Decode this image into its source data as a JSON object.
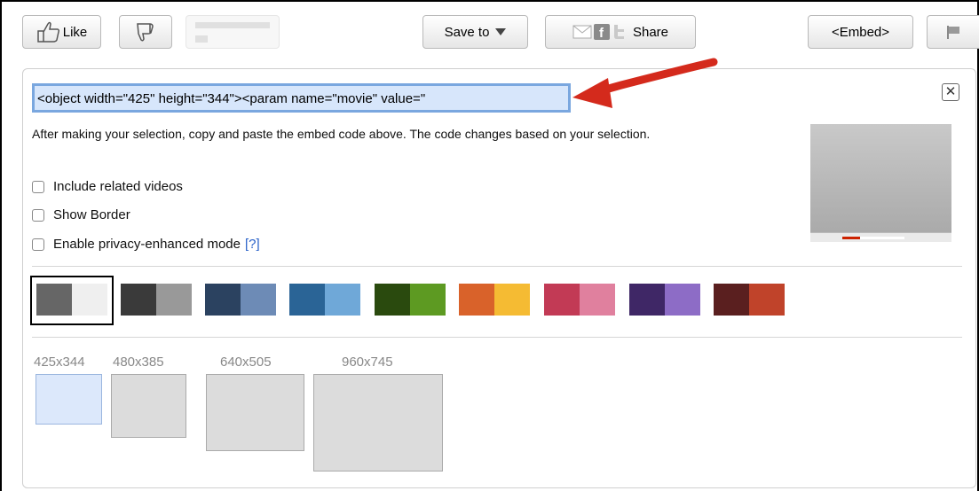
{
  "toolbar": {
    "like_label": "Like",
    "save_to_label": "Save to",
    "share_label": "Share",
    "embed_label": "<Embed>"
  },
  "embed": {
    "code": "<object width=\"425\" height=\"344\"><param name=\"movie\" value=\"",
    "description": "After making your selection, copy and paste the embed code above. The code changes based on your selection.",
    "options": [
      {
        "label": "Include related videos",
        "checked": false
      },
      {
        "label": "Show Border",
        "checked": false
      },
      {
        "label": "Enable privacy-enhanced mode",
        "checked": false,
        "help": "[?]"
      }
    ],
    "close_glyph": "✕"
  },
  "colors": [
    {
      "left": "#666666",
      "right": "#efefef",
      "selected": true
    },
    {
      "left": "#3a3a3a",
      "right": "#999999",
      "selected": false
    },
    {
      "left": "#2b4260",
      "right": "#6d8bb6",
      "selected": false
    },
    {
      "left": "#2a6496",
      "right": "#6fa8d8",
      "selected": false
    },
    {
      "left": "#2a4a0e",
      "right": "#5d9a22",
      "selected": false
    },
    {
      "left": "#d9622a",
      "right": "#f5bb33",
      "selected": false
    },
    {
      "left": "#c23a55",
      "right": "#e0809e",
      "selected": false
    },
    {
      "left": "#3f2766",
      "right": "#8d6cc6",
      "selected": false
    },
    {
      "left": "#5a1f1f",
      "right": "#c0432a",
      "selected": false
    }
  ],
  "sizes": [
    {
      "label": "425x344",
      "selected": true
    },
    {
      "label": "480x385",
      "selected": false
    },
    {
      "label": "640x505",
      "selected": false
    },
    {
      "label": "960x745",
      "selected": false
    }
  ]
}
